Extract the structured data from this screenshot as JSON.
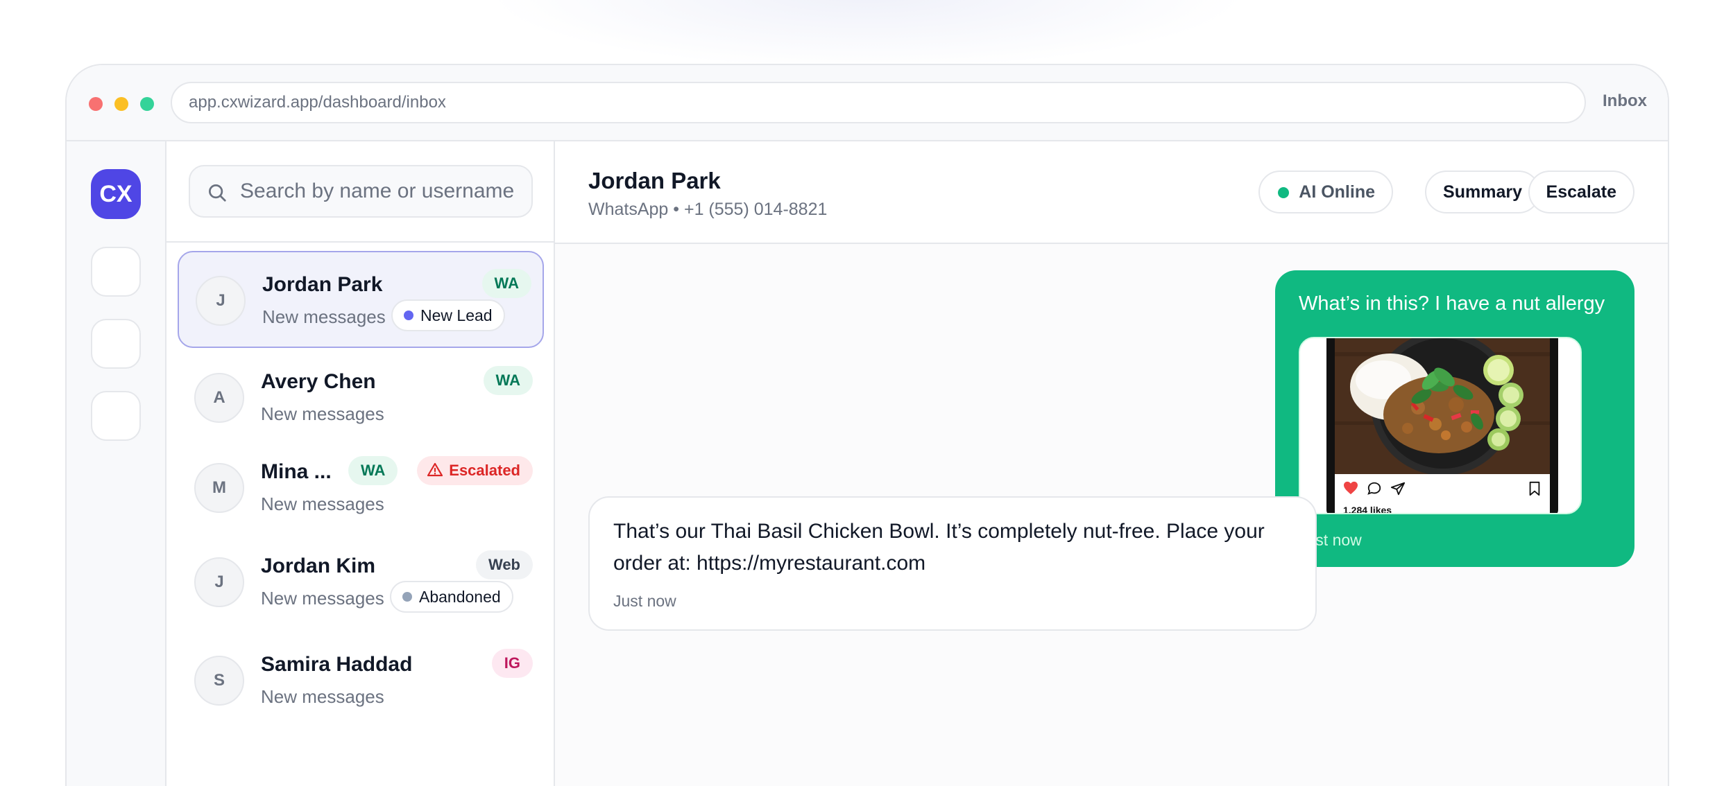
{
  "window": {
    "url": "app.cxwizard.app/dashboard/inbox",
    "title": "Inbox"
  },
  "rail": {
    "logo": "CX"
  },
  "search": {
    "placeholder": "Search by name or username",
    "icon": "search-icon"
  },
  "conversations": [
    {
      "initial": "J",
      "name": "Jordan Park",
      "preview": "New messages",
      "channel": "WA",
      "tag": "New Lead",
      "tag_color": "#6366f1",
      "active": true
    },
    {
      "initial": "A",
      "name": "Avery Chen",
      "preview": "New messages",
      "channel": "WA"
    },
    {
      "initial": "M",
      "name": "Mina ...",
      "preview": "New messages",
      "channel": "WA",
      "status": "Escalated"
    },
    {
      "initial": "J",
      "name": "Jordan Kim",
      "preview": "New messages",
      "channel": "Web",
      "tag": "Abandoned",
      "tag_color": "#94a3b8"
    },
    {
      "initial": "S",
      "name": "Samira Haddad",
      "preview": "New messages",
      "channel": "IG"
    }
  ],
  "chat": {
    "contact_name": "Jordan Park",
    "contact_meta": "WhatsApp • +1 (555) 014-8821",
    "ai_status": "AI Online",
    "summary_label": "Summary",
    "escalate_label": "Escalate",
    "messages": [
      {
        "direction": "outgoing",
        "text": "What’s in this? I have a nut allergy",
        "attachment_likes": "1,284 likes",
        "time": "Just now"
      },
      {
        "direction": "incoming",
        "text": "That’s our Thai Basil Chicken Bowl. It’s completely nut-free. Place your order at: https://myrestaurant.com",
        "time": "Just now"
      }
    ]
  },
  "colors": {
    "accent": "#4f46e5",
    "outgoing_bubble": "#10b981",
    "escalated": "#dc2626",
    "whatsapp_chip": "#047857",
    "instagram_chip": "#be185d"
  }
}
